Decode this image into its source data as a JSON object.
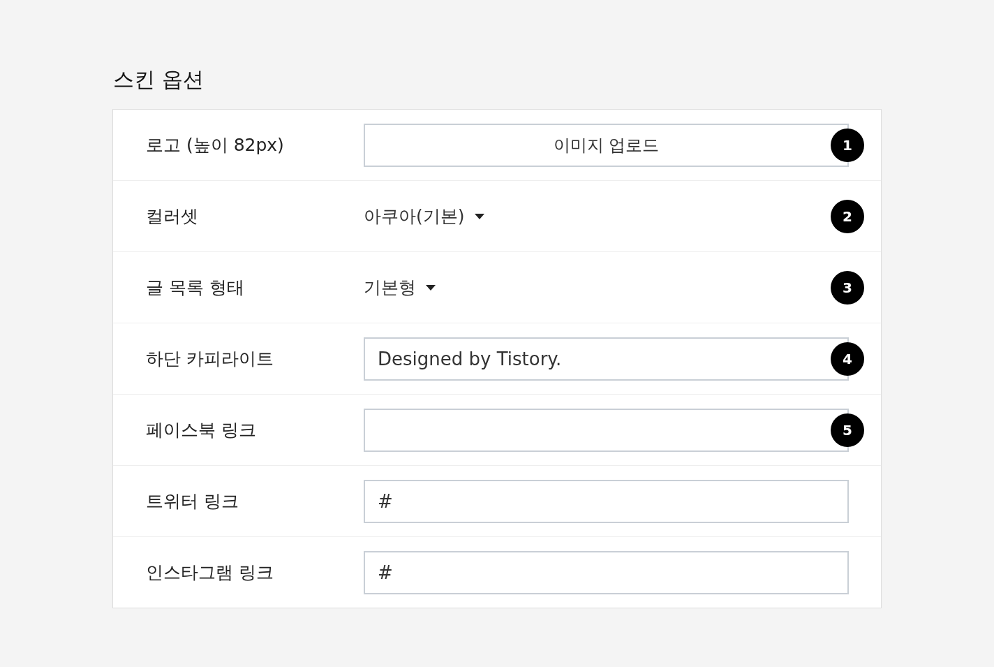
{
  "title": "스킨 옵션",
  "rows": [
    {
      "label": "로고 (높이 82px)",
      "kind": "button",
      "text": "이미지 업로드",
      "marker": "1"
    },
    {
      "label": "컬러셋",
      "kind": "select",
      "text": "아쿠아(기본)",
      "marker": "2"
    },
    {
      "label": "글 목록 형태",
      "kind": "select",
      "text": "기본형",
      "marker": "3"
    },
    {
      "label": "하단 카피라이트",
      "kind": "input",
      "value": "Designed by Tistory.",
      "marker": "4"
    },
    {
      "label": "페이스북 링크",
      "kind": "input",
      "marker": "5"
    },
    {
      "label": "트위터 링크",
      "kind": "input",
      "value": "#"
    },
    {
      "label": "인스타그램 링크",
      "kind": "input",
      "value": "#"
    }
  ]
}
